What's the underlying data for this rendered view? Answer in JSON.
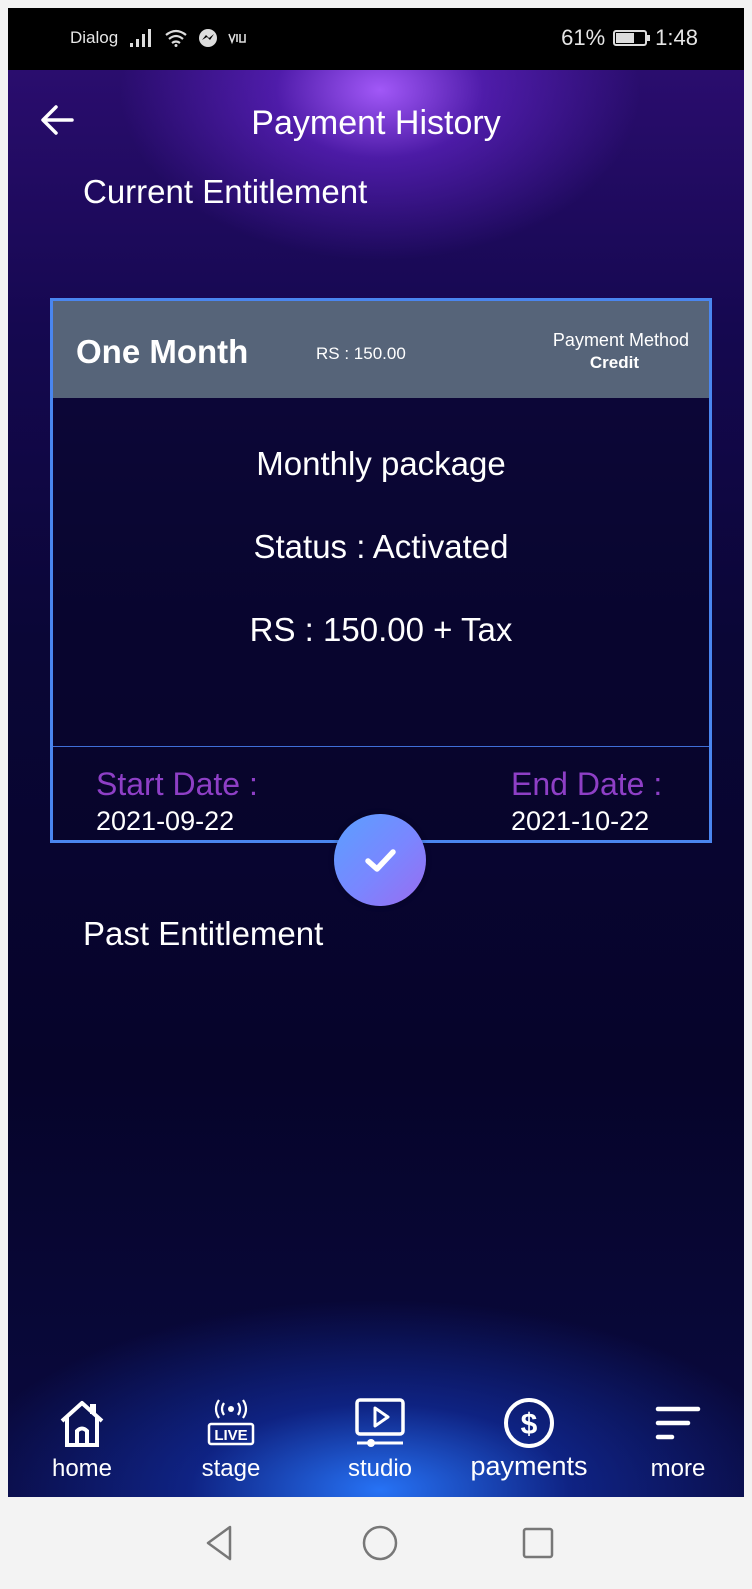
{
  "status_bar": {
    "carrier": "Dialog",
    "battery": "61%",
    "battery_level": 0.61,
    "time": "1:48"
  },
  "header": {
    "title": "Payment History"
  },
  "current": {
    "section_label": "Current Entitlement",
    "plan_name": "One Month",
    "plan_price": "RS : 150.00",
    "payment_method_label": "Payment Method",
    "payment_method_value": "Credit",
    "package_name": "Monthly package",
    "status": "Status : Activated",
    "price_with_tax": "RS : 150.00 + Tax",
    "start_label": "Start Date :",
    "start_date": "2021-09-22",
    "end_label": "End Date :",
    "end_date": "2021-10-22"
  },
  "past": {
    "section_label": "Past Entitlement"
  },
  "nav": {
    "home": "home",
    "stage": "stage",
    "studio": "studio",
    "payments": "payments",
    "more": "more",
    "live_badge": "LIVE"
  },
  "colors": {
    "accent_border": "#4a86f0",
    "card_header": "#566479",
    "date_label": "#8e3fc6"
  }
}
